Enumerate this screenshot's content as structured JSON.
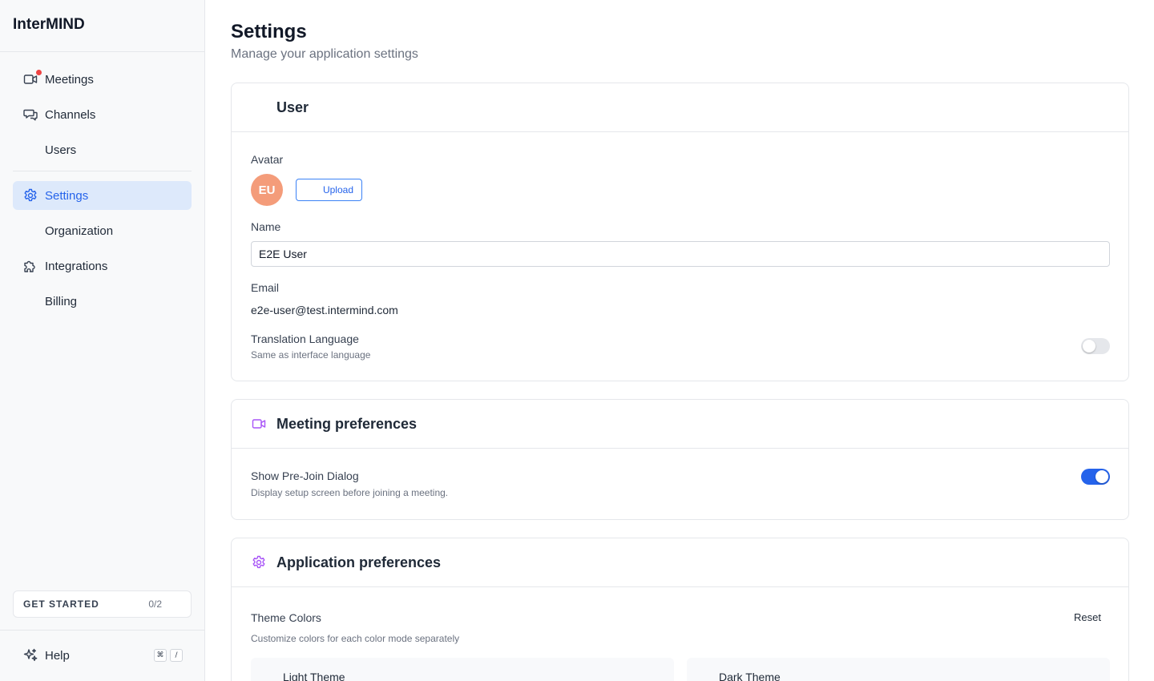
{
  "app": {
    "brand": "InterMIND"
  },
  "sidebar": {
    "items": [
      {
        "label": "Meetings",
        "icon": "video-camera-icon",
        "notification": true
      },
      {
        "label": "Channels",
        "icon": "chat-bubbles-icon"
      },
      {
        "label": "Users"
      },
      {
        "label": "Settings",
        "icon": "gear-icon",
        "active": true
      },
      {
        "label": "Organization"
      },
      {
        "label": "Integrations",
        "icon": "puzzle-icon"
      },
      {
        "label": "Billing"
      }
    ],
    "get_started": {
      "label": "GET STARTED",
      "count": "0/2"
    },
    "help": {
      "label": "Help",
      "icon": "sparkles-icon",
      "shortcut": [
        "⌘",
        "/"
      ]
    }
  },
  "page": {
    "title": "Settings",
    "subtitle": "Manage your application settings"
  },
  "user_card": {
    "title": "User",
    "avatar_label": "Avatar",
    "avatar_initials": "EU",
    "avatar_color": "#f49c7a",
    "upload_label": "Upload",
    "name_label": "Name",
    "name_value": "E2E User",
    "email_label": "Email",
    "email_value": "e2e-user@test.intermind.com",
    "translation_label": "Translation Language",
    "translation_desc": "Same as interface language",
    "translation_enabled": false
  },
  "meeting_card": {
    "title": "Meeting preferences",
    "icon": "video-camera-icon",
    "prejoin_label": "Show Pre-Join Dialog",
    "prejoin_desc": "Display setup screen before joining a meeting.",
    "prejoin_enabled": true
  },
  "app_card": {
    "title": "Application preferences",
    "icon": "gear-icon",
    "theme_label": "Theme Colors",
    "theme_desc": "Customize colors for each color mode separately",
    "reset_label": "Reset",
    "light_theme_label": "Light Theme",
    "dark_theme_label": "Dark Theme"
  },
  "colors": {
    "accent": "#2563eb",
    "active_bg": "#dde9fb",
    "notification": "#ef4444",
    "card_icon": "#a855f7"
  }
}
